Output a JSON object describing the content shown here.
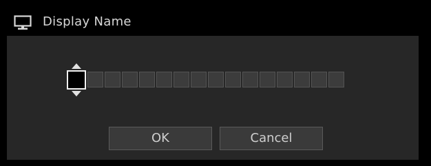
{
  "dialog": {
    "title": "Display Name",
    "title_icon": "monitor-icon"
  },
  "name_editor": {
    "total_cells": 16,
    "active_cell_index": 0,
    "characters": [
      "",
      "",
      "",
      "",
      "",
      "",
      "",
      "",
      "",
      "",
      "",
      "",
      "",
      "",
      "",
      ""
    ]
  },
  "buttons": {
    "ok_label": "OK",
    "cancel_label": "Cancel"
  },
  "colors": {
    "background": "#000000",
    "panel": "#272727",
    "cell": "#3c3c3c",
    "active_cell_border": "#f2f2f2",
    "text": "#cfcfcf"
  }
}
